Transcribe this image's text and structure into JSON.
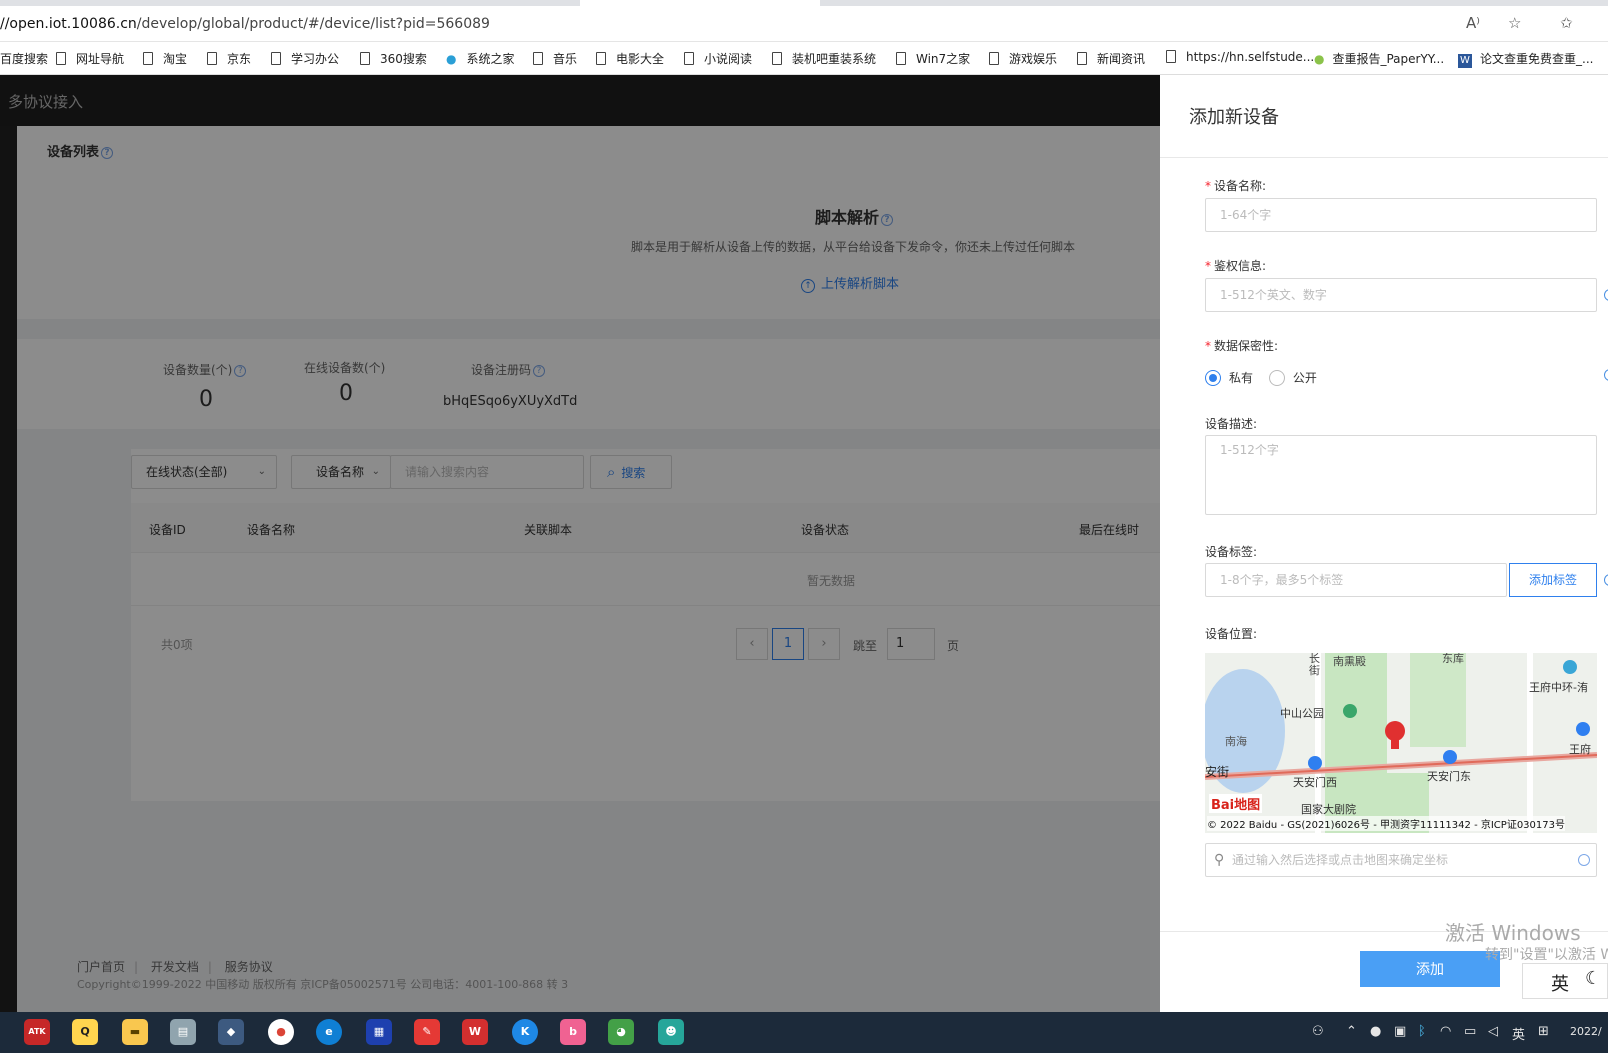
{
  "browser": {
    "url_host": "//open.iot.10086.cn",
    "url_path": "/develop/global/product/#/device/list?pid=566089",
    "bookmarks": [
      "百度搜索",
      "网址导航",
      "淘宝",
      "京东",
      "学习办公",
      "360搜索",
      "系统之家",
      "音乐",
      "电影大全",
      "小说阅读",
      "装机吧重装系统",
      "Win7之家",
      "游戏娱乐",
      "新闻资讯",
      "https://hn.selfstude...",
      "查重报告_PaperYY...",
      "论文查重免费查重_..."
    ]
  },
  "app": {
    "brand": "多协议接入",
    "device_list_title": "设备列表",
    "script": {
      "title": "脚本解析",
      "desc": "脚本是用于解析从设备上传的数据，从平台给设备下发命令，你还未上传过任何脚本",
      "upload": "上传解析脚本"
    },
    "stats": [
      {
        "label": "设备数量(个)",
        "value": "0"
      },
      {
        "label": "在线设备数(个)",
        "value": "0"
      },
      {
        "label": "设备注册码",
        "value": "bHqESqo6yXUyXdTd"
      }
    ],
    "filters": {
      "status": "在线状态(全部)",
      "field": "设备名称",
      "search_placeholder": "请输入搜索内容",
      "search_button": "搜索"
    },
    "table": {
      "columns": [
        "设备ID",
        "设备名称",
        "关联脚本",
        "设备状态",
        "最后在线时"
      ],
      "empty": "暂无数据"
    },
    "pagination": {
      "total": "共0项",
      "current": "1",
      "jump_label": "跳至",
      "jump_value": "1",
      "page_unit": "页"
    },
    "footer": {
      "links": [
        "门户首页",
        "开发文档",
        "服务协议"
      ],
      "copyright": "Copyright©1999-2022 中国移动 版权所有 京ICP备05002571号 公司电话：4001-100-868 转 3"
    }
  },
  "drawer": {
    "title": "添加新设备",
    "fields": {
      "name_label": "设备名称:",
      "name_placeholder": "1-64个字",
      "auth_label": "鉴权信息:",
      "auth_placeholder": "1-512个英文、数字",
      "privacy_label": "数据保密性:",
      "privacy_private": "私有",
      "privacy_public": "公开",
      "desc_label": "设备描述:",
      "desc_placeholder": "1-512个字",
      "tags_label": "设备标签:",
      "tags_placeholder": "1-8个字，最多5个标签",
      "add_tag": "添加标签",
      "location_label": "设备位置:",
      "location_placeholder": "通过输入然后选择或点击地图来确定坐标"
    },
    "map": {
      "labels": [
        "南熏殿",
        "长街",
        "东库",
        "中山公园",
        "王府中环-洧",
        "南海",
        "王府",
        "安街",
        "天安门西",
        "天安门东",
        "国家大剧院"
      ],
      "logo": "Bai地图",
      "copyright": "© 2022 Baidu - GS(2021)6026号 - 甲测资字11111342 - 京ICP证030173号"
    },
    "submit": "添加"
  },
  "overlay_text": {
    "activate": "激活 Windows",
    "activate_sub": "转到\"设置\"以激活 Wind",
    "ime": "英"
  },
  "taskbar": {
    "tray_lang": "英",
    "clock": "2022/"
  },
  "colors": {
    "primary": "#2f80ed",
    "button": "#4a9ff5",
    "required": "#f5222d",
    "appbar": "#1f1f1f"
  }
}
